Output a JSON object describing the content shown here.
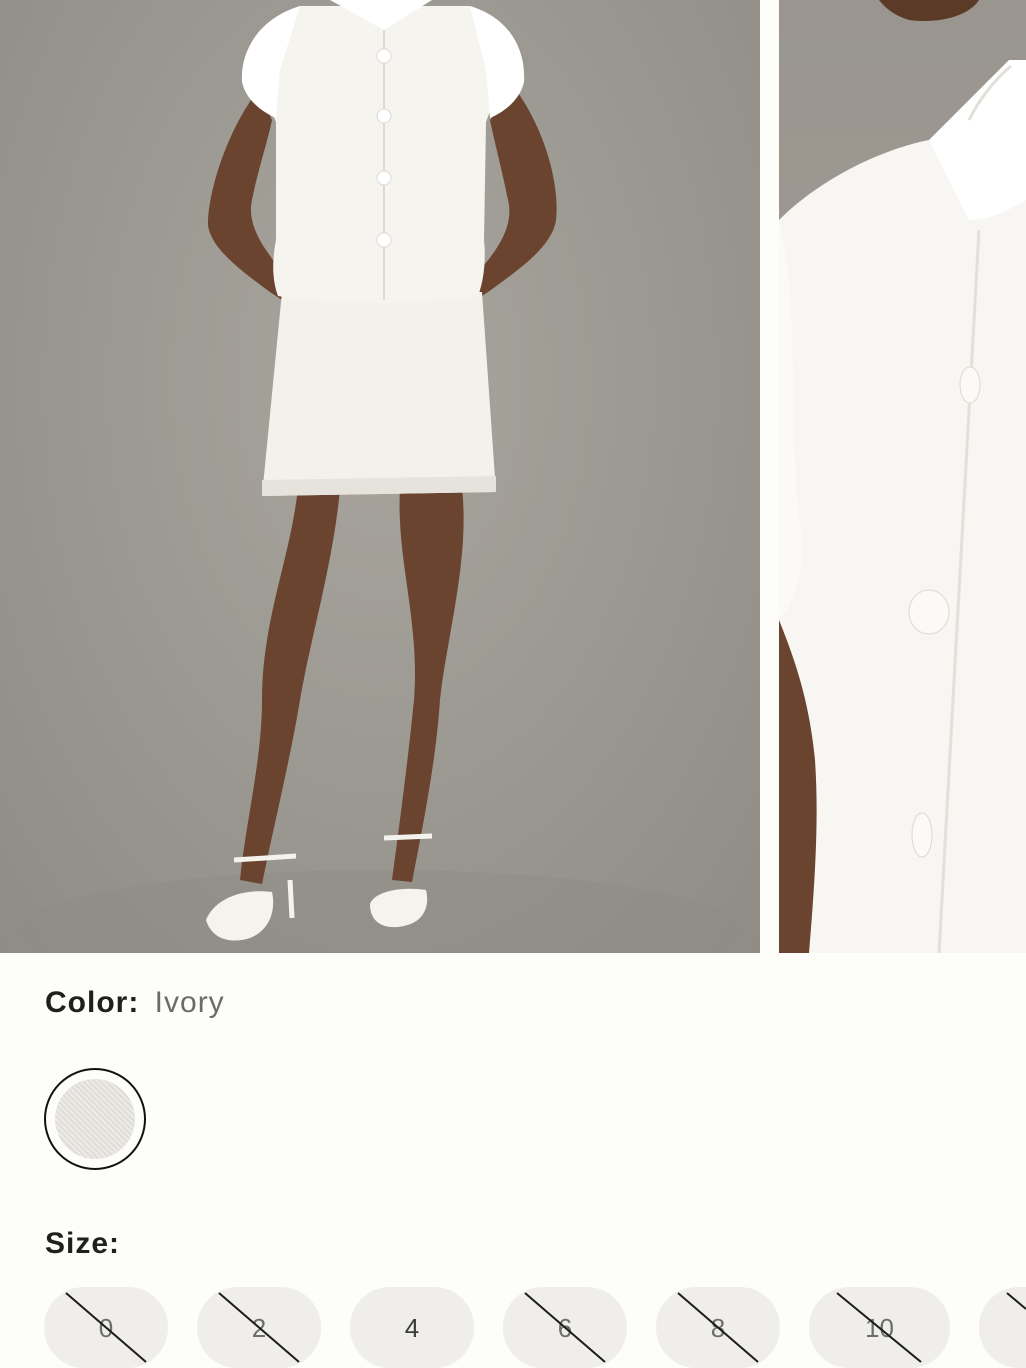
{
  "gallery": {
    "images": [
      {
        "icon": "model-full-length-photo"
      },
      {
        "icon": "collar-detail-photo"
      }
    ]
  },
  "color": {
    "label": "Color:",
    "value": "Ivory",
    "swatch_color": "#e4e1dc"
  },
  "size": {
    "label": "Size:",
    "options": [
      {
        "label": "0",
        "available": false
      },
      {
        "label": "2",
        "available": false
      },
      {
        "label": "4",
        "available": true
      },
      {
        "label": "6",
        "available": false
      },
      {
        "label": "8",
        "available": false
      },
      {
        "label": "10",
        "available": false
      },
      {
        "label": "",
        "available": false
      }
    ]
  },
  "colors": {
    "background": "#fdfdf9",
    "pill": "#efeeea",
    "text": "#1f1f1f",
    "muted": "#6b6b6b"
  }
}
